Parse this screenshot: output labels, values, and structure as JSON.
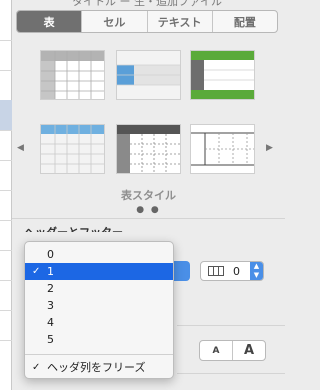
{
  "titlebar": {
    "title": "タイトル ー 生・追加ファイル"
  },
  "tabs": [
    {
      "label": "表",
      "active": true
    },
    {
      "label": "セル",
      "active": false
    },
    {
      "label": "テキスト",
      "active": false
    },
    {
      "label": "配置",
      "active": false
    }
  ],
  "styles": {
    "label": "表スタイル",
    "page_dots": "● ●",
    "left_arrow": "◀",
    "right_arrow": "▶"
  },
  "peek_text": "ヘッダーとフッター",
  "header_columns": {
    "value": "0"
  },
  "font_size_buttons": {
    "smaller": "A",
    "larger": "A"
  },
  "menu": {
    "items": [
      {
        "label": "0",
        "checked": false,
        "selected": false
      },
      {
        "label": "1",
        "checked": true,
        "selected": true
      },
      {
        "label": "2",
        "checked": false,
        "selected": false
      },
      {
        "label": "3",
        "checked": false,
        "selected": false
      },
      {
        "label": "4",
        "checked": false,
        "selected": false
      },
      {
        "label": "5",
        "checked": false,
        "selected": false
      }
    ],
    "freeze": {
      "label": "ヘッダ列をフリーズ",
      "checked": true
    }
  },
  "colors": {
    "accent": "#1c67e4",
    "tab_active": "#707070",
    "green": "#5aaa3a",
    "light_blue": "#6fb0e0",
    "dark_gray": "#555555"
  }
}
